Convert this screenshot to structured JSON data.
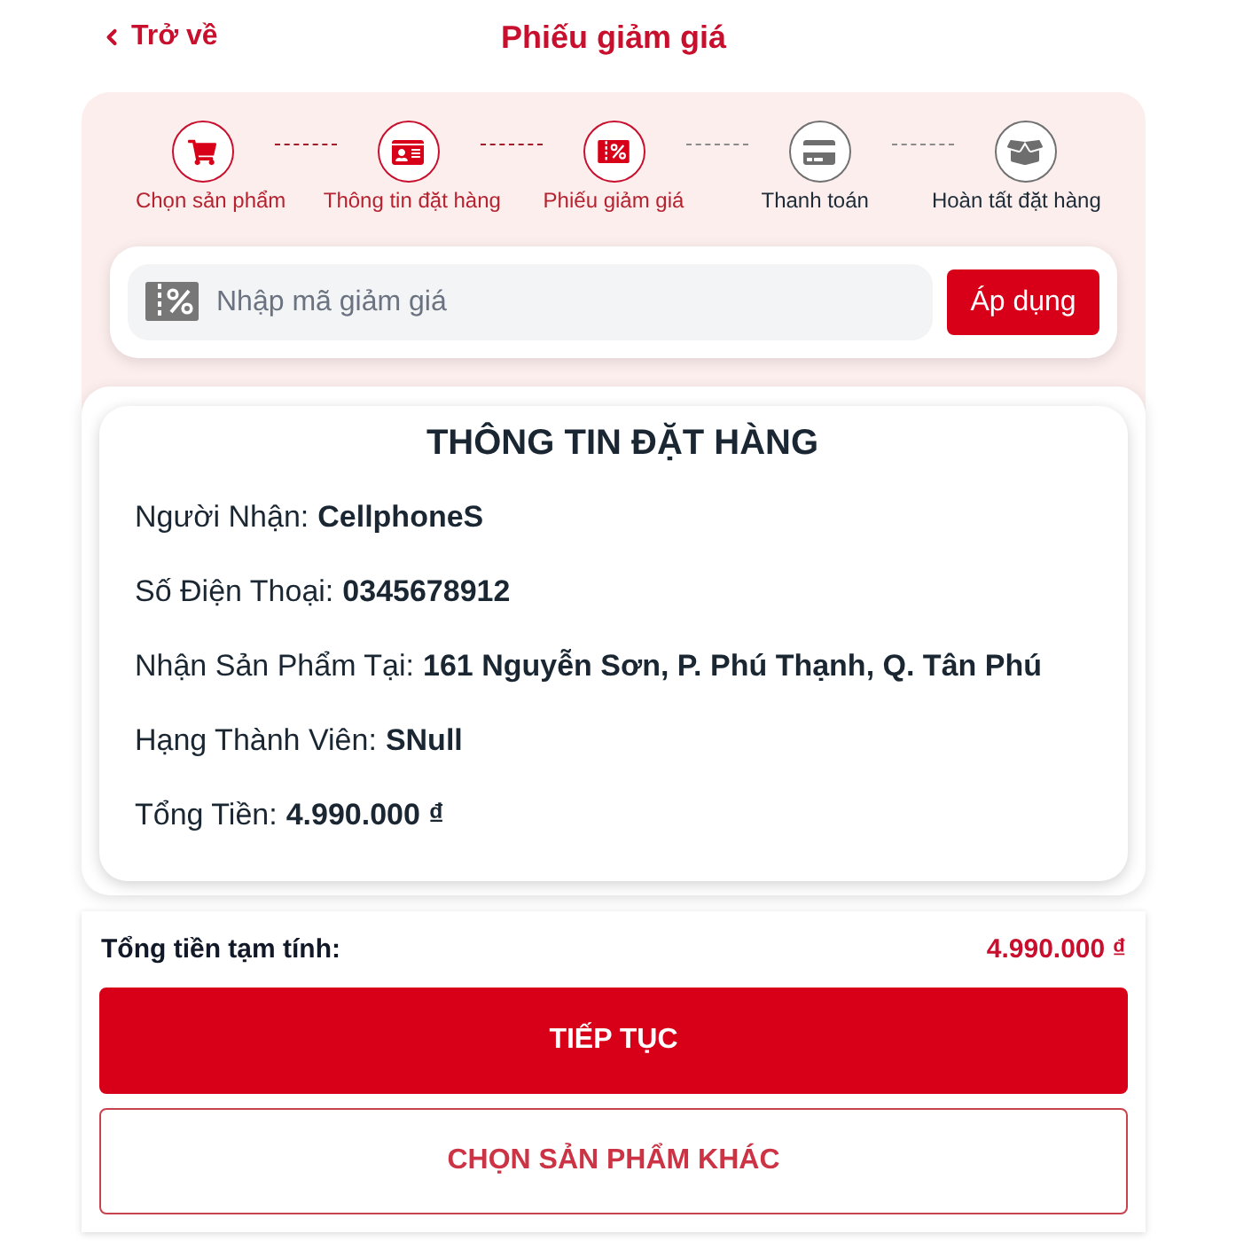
{
  "header": {
    "back": "Trở về",
    "title": "Phiếu giảm giá"
  },
  "steps": [
    {
      "label": "Chọn sản phẩm",
      "completed": true
    },
    {
      "label": "Thông tin đặt hàng",
      "completed": true
    },
    {
      "label": "Phiếu giảm giá",
      "completed": true
    },
    {
      "label": "Thanh toán",
      "completed": false
    },
    {
      "label": "Hoàn tất đặt hàng",
      "completed": false
    }
  ],
  "coupon": {
    "placeholder": "Nhập mã giảm giá",
    "button": "Áp dụng"
  },
  "order_info": {
    "title": "THÔNG TIN ĐẶT HÀNG",
    "rows": [
      {
        "label": "Người Nhận:",
        "value": "CellphoneS"
      },
      {
        "label": "Số Điện Thoại:",
        "value": "0345678912"
      },
      {
        "label": "Nhận Sản Phẩm Tại:",
        "value": "161 Nguyễn Sơn, P. Phú Thạnh, Q. Tân Phú"
      },
      {
        "label": "Hạng Thành Viên:",
        "value": "SNull"
      },
      {
        "label": "Tổng Tiền:",
        "value": "4.990.000 ₫"
      }
    ]
  },
  "summary": {
    "label": "Tổng tiền tạm tính:",
    "amount": "4.990.000 ₫"
  },
  "buttons": [
    {
      "label": "TIẾP TỤC",
      "kind": "primary"
    },
    {
      "label": "CHỌN SẢN PHẨM KHÁC",
      "kind": "outline"
    }
  ]
}
